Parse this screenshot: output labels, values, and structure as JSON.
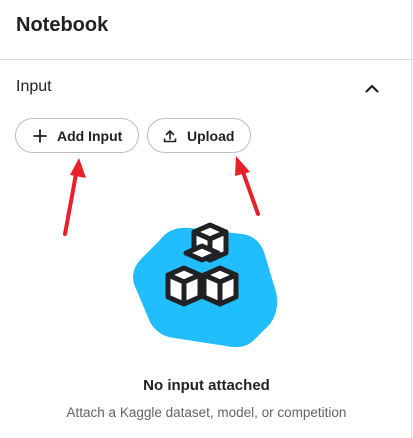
{
  "panel": {
    "title": "Notebook"
  },
  "input_section": {
    "title": "Input",
    "collapse_icon": "chevron-up-icon",
    "buttons": [
      {
        "label": "Add Input",
        "icon": "plus-icon"
      },
      {
        "label": "Upload",
        "icon": "upload-icon"
      }
    ]
  },
  "empty_state": {
    "illustration": "cubes-icon",
    "title": "No input attached",
    "subtitle": "Attach a Kaggle dataset, model, or competition"
  },
  "colors": {
    "accent_blue": "#20beff",
    "annotation_red": "#e8202a",
    "text": "#202124",
    "muted_text": "#5f6368",
    "border": "#dadce0"
  }
}
